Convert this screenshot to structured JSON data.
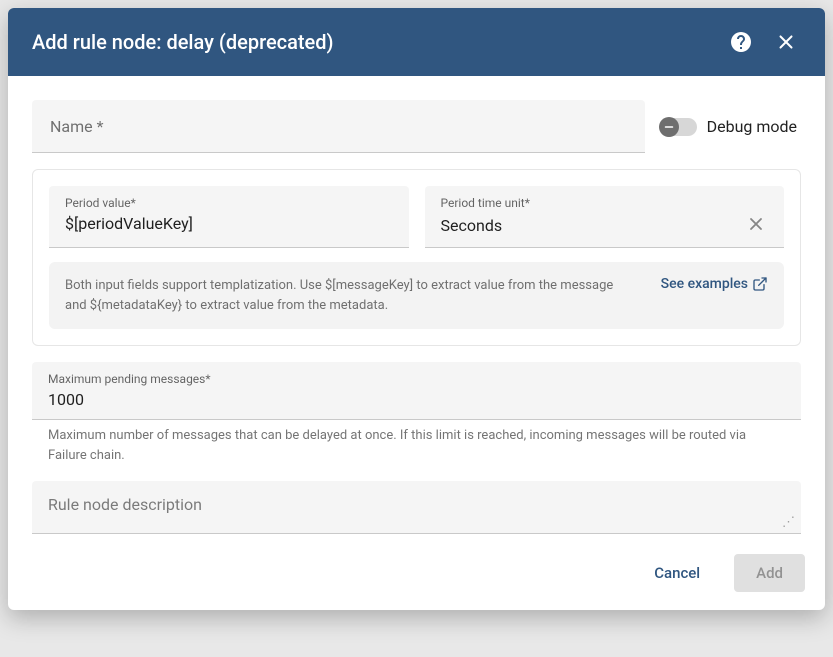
{
  "header": {
    "title": "Add rule node: delay (deprecated)"
  },
  "fields": {
    "name": {
      "label": "Name *"
    },
    "debug_mode": {
      "label": "Debug mode",
      "on": false
    },
    "period_value": {
      "label": "Period value*",
      "value": "$[periodValueKey]"
    },
    "period_unit": {
      "label": "Period time unit*",
      "value": "Seconds"
    },
    "max_pending": {
      "label": "Maximum pending messages*",
      "value": "1000",
      "help": "Maximum number of messages that can be delayed at once. If this limit is reached, incoming messages will be routed via Failure chain."
    },
    "description": {
      "placeholder": "Rule node description"
    }
  },
  "hints": {
    "templatization": "Both input fields support templatization. Use $[messageKey] to extract value from the message and ${metadataKey} to extract value from the metadata.",
    "examples_link": "See examples"
  },
  "footer": {
    "cancel": "Cancel",
    "add": "Add"
  }
}
